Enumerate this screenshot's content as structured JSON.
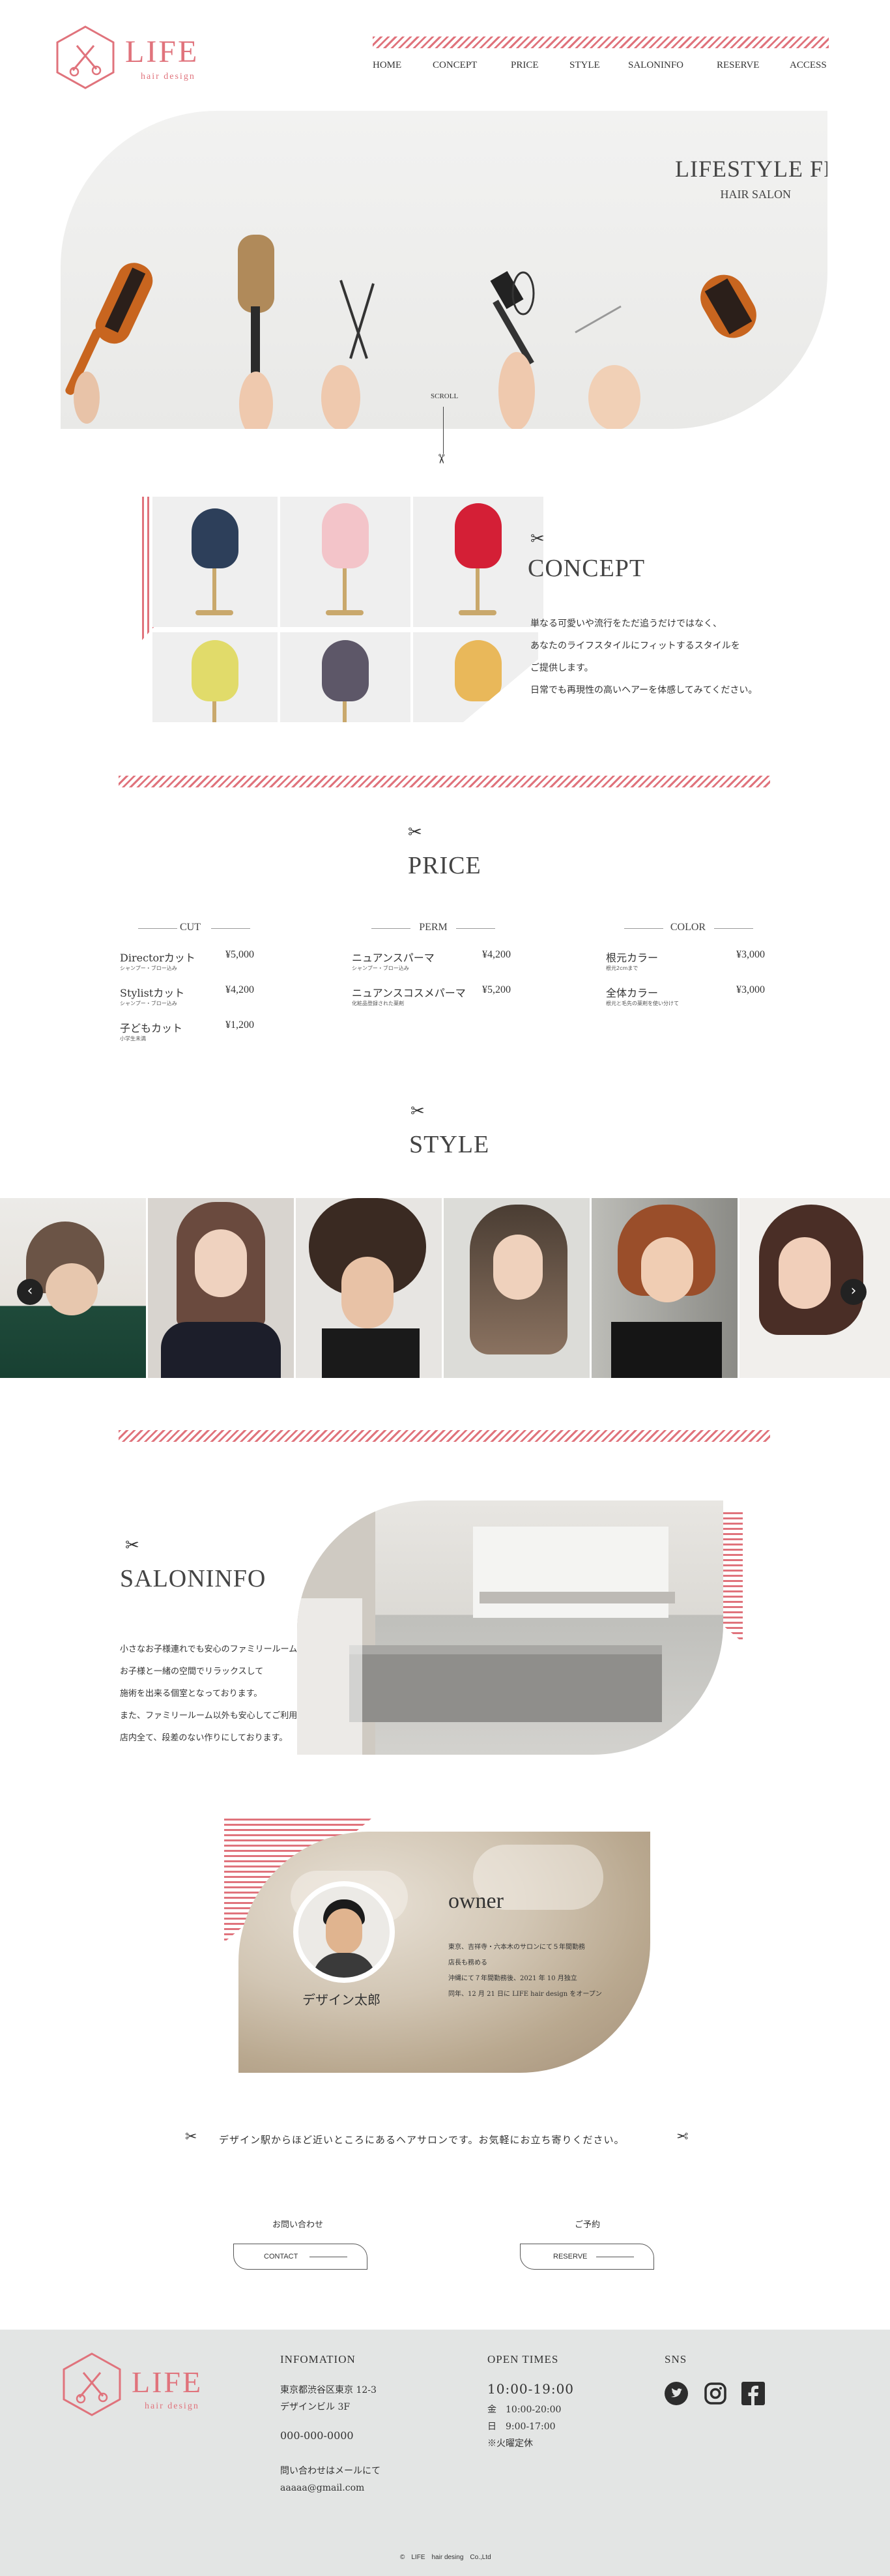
{
  "header": {
    "logo_text": "LIFE",
    "logo_sub": "hair design",
    "nav": [
      "HOME",
      "CONCEPT",
      "PRICE",
      "STYLE",
      "SALONINFO",
      "RESERVE",
      "ACCESS"
    ]
  },
  "hero": {
    "title": "LIFESTYLE FIT",
    "subtitle": "HAIR SALON",
    "scroll_label": "SCROLL"
  },
  "concept": {
    "title": "CONCEPT",
    "lines": [
      "単なる可愛いや流行をただ追うだけではなく、",
      "あなたのライフスタイルにフィットするスタイルを",
      "ご提供します。",
      "日常でも再現性の高いヘアーを体感してみてください。"
    ]
  },
  "price": {
    "title": "PRICE",
    "groups": [
      {
        "heading": "CUT",
        "items": [
          {
            "name": "Directorカット",
            "sub": "シャンプー・ブロー込み",
            "price": "¥5,000"
          },
          {
            "name": "Stylistカット",
            "sub": "シャンプー・ブロー込み",
            "price": "¥4,200"
          },
          {
            "name": "子どもカット",
            "sub": "小学生未満",
            "price": "¥1,200"
          }
        ]
      },
      {
        "heading": "PERM",
        "items": [
          {
            "name": "ニュアンスパーマ",
            "sub": "シャンプー・ブロー込み",
            "price": "¥4,200"
          },
          {
            "name": "ニュアンスコスメパーマ",
            "sub": "化粧品登録された薬剤",
            "price": "¥5,200"
          }
        ]
      },
      {
        "heading": "COLOR",
        "items": [
          {
            "name": "根元カラー",
            "sub": "根元2cmまで",
            "price": "¥3,000"
          },
          {
            "name": "全体カラー",
            "sub": "根元と毛先の薬剤を使い分けて",
            "price": "¥3,000"
          }
        ]
      }
    ]
  },
  "style": {
    "title": "STYLE",
    "prev_icon": "chevron-left-icon",
    "next_icon": "chevron-right-icon"
  },
  "saloninfo": {
    "title": "SALONINFO",
    "lines": [
      "小さなお子様連れでも安心のファミリールームを完備。",
      "お子様と一緒の空間でリラックスして",
      "施術を出来る個室となっております。",
      "また、ファミリールーム以外も安心してご利用頂けるよう、",
      "店内全て、段差のない作りにしております。"
    ]
  },
  "owner": {
    "title": "owner",
    "name": "デザイン太郎",
    "lines": [
      "東京、吉祥寺・六本木のサロンにて５年間勤務",
      "店長も務める",
      "沖縄にて７年間勤務後、2021 年 10 月独立",
      "同年、12 月 21 日に LIFE hair design をオープン"
    ]
  },
  "access_message": "デザイン駅からほど近いところにあるヘアサロンです。お気軽にお立ち寄りください。",
  "cta": {
    "contact_caption": "お問い合わせ",
    "contact_label": "CONTACT",
    "reserve_caption": "ご予約",
    "reserve_label": "RESERVE"
  },
  "footer": {
    "info_heading": "INFOMATION",
    "address": [
      "東京都渋谷区東京 12-3",
      "デザインビル 3F"
    ],
    "phone": "000-000-0000",
    "mail_note": "問い合わせはメールにて",
    "email": "aaaaa@gmail.com",
    "hours_heading": "OPEN TIMES",
    "hours_main": "10:00-19:00",
    "hours_lines": [
      "金　10:00-20:00",
      "日　9:00-17:00",
      "※火曜定休"
    ],
    "sns_heading": "SNS",
    "copyright": "©　LIFE　hair desing　Co.,Ltd"
  },
  "colors": {
    "accent": "#e0737c",
    "footer_bg": "#e3e5e4"
  }
}
